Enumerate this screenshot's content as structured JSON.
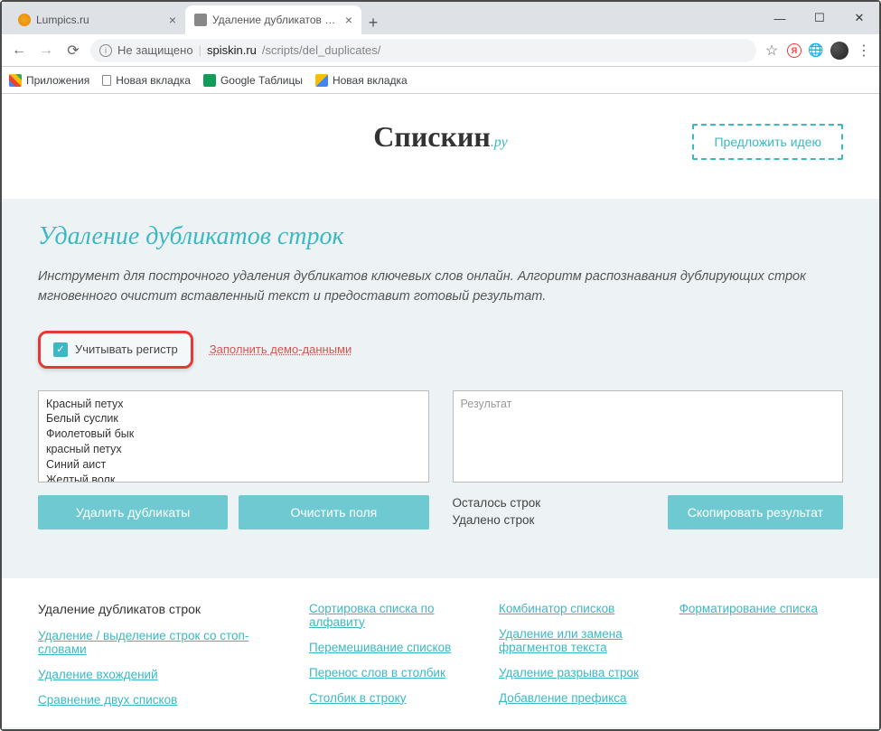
{
  "browser": {
    "tabs": [
      {
        "title": "Lumpics.ru",
        "favicon": "orange"
      },
      {
        "title": "Удаление дубликатов строк - уд",
        "favicon": "gray",
        "active": true
      }
    ],
    "url_insecure_label": "Не защищено",
    "url_domain": "spiskin.ru",
    "url_path": "/scripts/del_duplicates/",
    "bookmarks": [
      "Приложения",
      "Новая вкладка",
      "Google Таблицы",
      "Новая вкладка"
    ]
  },
  "page": {
    "logo_main": "Спискин",
    "logo_suffix": ".ру",
    "suggest_button": "Предложить идею",
    "heading": "Удаление дубликатов строк",
    "description": "Инструмент для построчного удаления дубликатов ключевых слов онлайн. Алгоритм распознавания дублирующих строк мгновенного очистит вставленный текст и предоставит готовый результат.",
    "case_checkbox_label": "Учитывать регистр",
    "case_checkbox_checked": true,
    "demo_link": "Заполнить демо-данными",
    "input_text": "Красный петух\nБелый суслик\nФиолетовый бык\nкрасный петух\nСиний аист\nЖелтый волк\nОранжевый медведь\nСиний аист",
    "result_placeholder": "Результат",
    "btn_remove": "Удалить дубликаты",
    "btn_clear": "Очистить поля",
    "btn_copy": "Скопировать результат",
    "stats_remaining": "Осталось строк",
    "stats_removed": "Удалено строк"
  },
  "footer": {
    "col1_head": "Удаление дубликатов строк",
    "col1": [
      "Удаление / выделение строк со стоп-словами",
      "Удаление вхождений",
      "Сравнение двух списков"
    ],
    "col2": [
      "Сортировка списка по алфавиту",
      "Перемешивание списков",
      "Перенос слов в столбик",
      "Столбик в строку"
    ],
    "col3": [
      "Комбинатор списков",
      "Удаление или замена фрагментов текста",
      "Удаление разрыва строк",
      "Добавление префикса"
    ],
    "col4": [
      "Форматирование списка"
    ]
  }
}
